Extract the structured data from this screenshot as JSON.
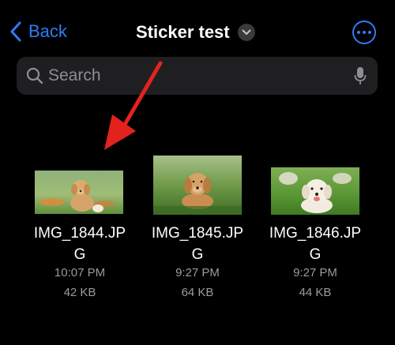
{
  "nav": {
    "back_label": "Back",
    "title": "Sticker test",
    "colors": {
      "accent": "#2f7cf6"
    }
  },
  "search": {
    "placeholder": "Search",
    "value": ""
  },
  "files": [
    {
      "name_line1": "IMG_1844.JP",
      "name_line2": "G",
      "time": "10:07 PM",
      "size": "42 KB"
    },
    {
      "name_line1": "IMG_1845.JP",
      "name_line2": "G",
      "time": "9:27 PM",
      "size": "64 KB"
    },
    {
      "name_line1": "IMG_1846.JP",
      "name_line2": "G",
      "time": "9:27 PM",
      "size": "44 KB"
    }
  ],
  "annotation": {
    "arrow_color": "#e3221e"
  }
}
